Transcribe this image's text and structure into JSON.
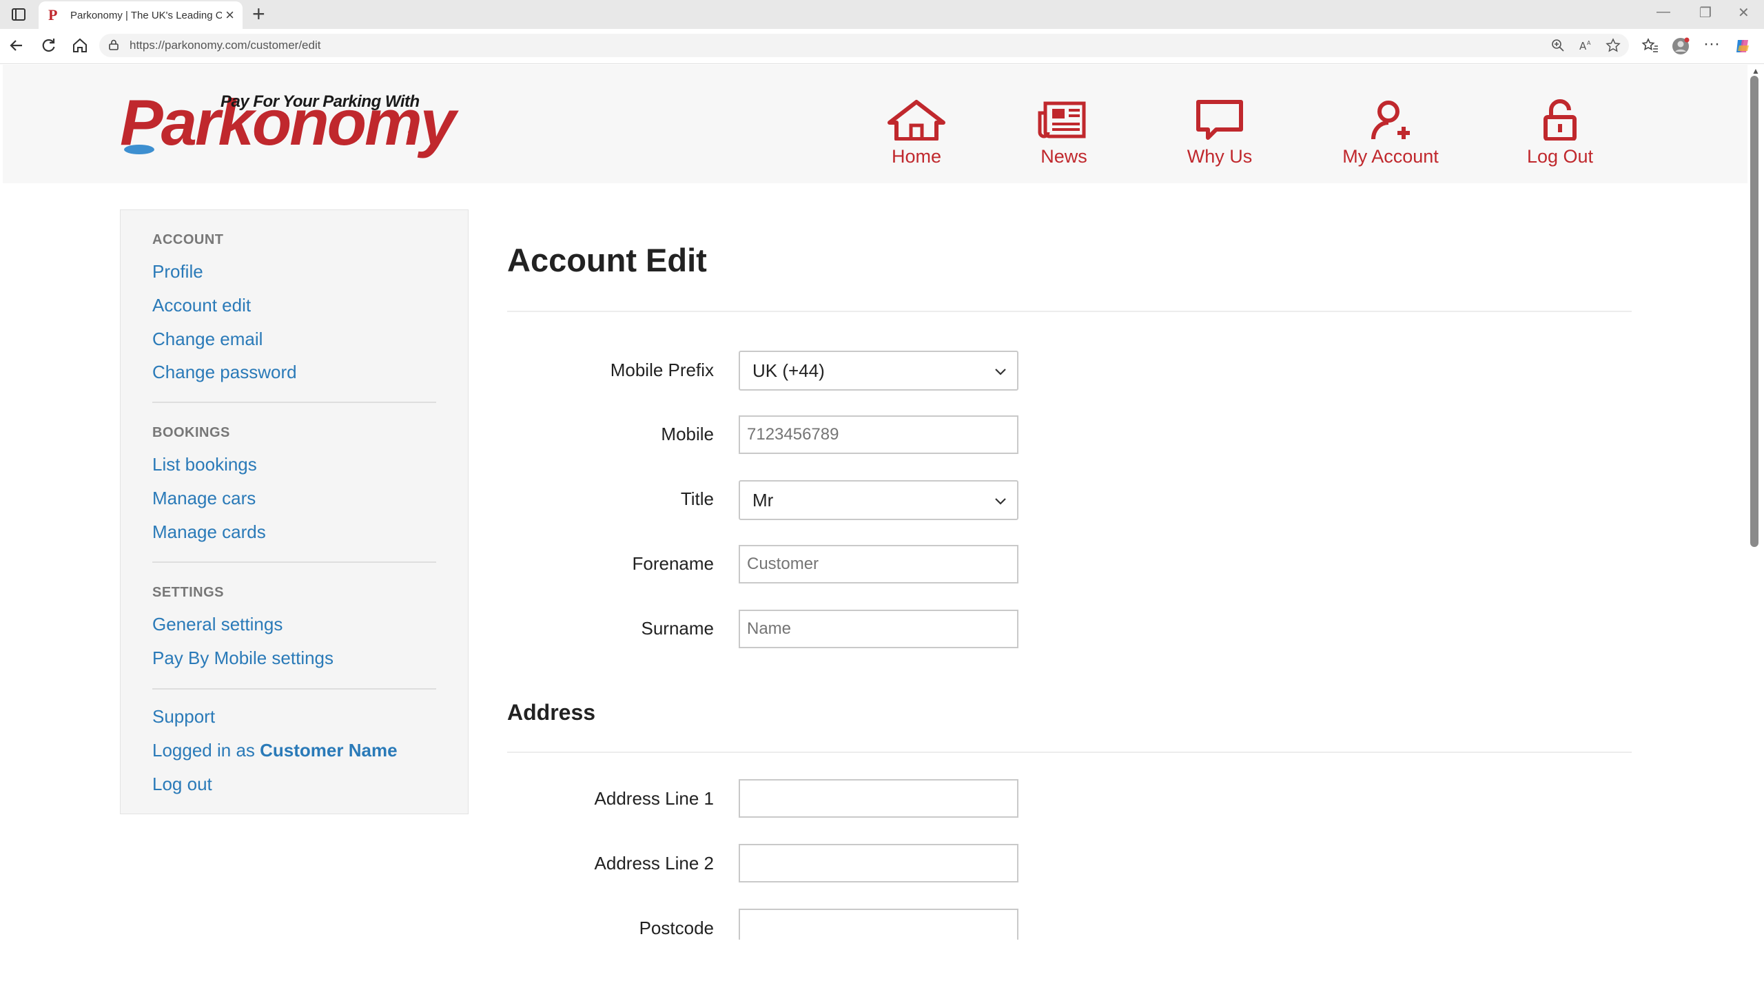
{
  "browser": {
    "tab_title": "Parkonomy | The UK's Leading Ca",
    "tab_favicon": "P",
    "url": "https://parkonomy.com/customer/edit"
  },
  "logo": {
    "tagline": "Pay For Your Parking With",
    "name": "Parkonomy",
    "registered": "®"
  },
  "topnav": [
    {
      "label": "Home",
      "icon": "home-icon"
    },
    {
      "label": "News",
      "icon": "newspaper-icon"
    },
    {
      "label": "Why Us",
      "icon": "chat-bubble-icon"
    },
    {
      "label": "My Account",
      "icon": "user-add-icon"
    },
    {
      "label": "Log Out",
      "icon": "unlock-icon"
    }
  ],
  "sidebar": {
    "account": {
      "heading": "ACCOUNT",
      "items": [
        "Profile",
        "Account edit",
        "Change email",
        "Change password"
      ]
    },
    "bookings": {
      "heading": "BOOKINGS",
      "items": [
        "List bookings",
        "Manage cars",
        "Manage cards"
      ]
    },
    "settings": {
      "heading": "SETTINGS",
      "items": [
        "General settings",
        "Pay By Mobile settings"
      ]
    },
    "footer": {
      "support": "Support",
      "logged_in_prefix": "Logged in as",
      "logged_in_name": "Customer Name",
      "logout": "Log out"
    }
  },
  "main": {
    "title": "Account Edit",
    "fields": {
      "mobile_prefix": {
        "label": "Mobile Prefix",
        "value": "UK (+44)"
      },
      "mobile": {
        "label": "Mobile",
        "placeholder": "7123456789"
      },
      "title": {
        "label": "Title",
        "value": "Mr"
      },
      "forename": {
        "label": "Forename",
        "placeholder": "Customer"
      },
      "surname": {
        "label": "Surname",
        "placeholder": "Name"
      }
    },
    "address": {
      "heading": "Address",
      "line1": {
        "label": "Address Line 1",
        "value": ""
      },
      "line2": {
        "label": "Address Line 2",
        "value": ""
      },
      "postcode": {
        "label": "Postcode",
        "value": ""
      }
    }
  },
  "colors": {
    "brand_red": "#c0282d",
    "link_blue": "#2a7ab8"
  }
}
